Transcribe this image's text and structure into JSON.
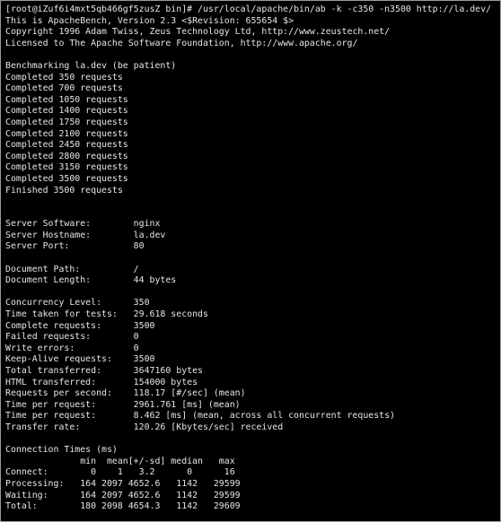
{
  "terminal": {
    "lines": [
      "[root@iZuf6i4mxt5qb466gf5zusZ bin]# /usr/local/apache/bin/ab -k -c350 -n3500 http://la.dev/",
      "This is ApacheBench, Version 2.3 <$Revision: 655654 $>",
      "Copyright 1996 Adam Twiss, Zeus Technology Ltd, http://www.zeustech.net/",
      "Licensed to The Apache Software Foundation, http://www.apache.org/",
      "",
      "Benchmarking la.dev (be patient)",
      "Completed 350 requests",
      "Completed 700 requests",
      "Completed 1050 requests",
      "Completed 1400 requests",
      "Completed 1750 requests",
      "Completed 2100 requests",
      "Completed 2450 requests",
      "Completed 2800 requests",
      "Completed 3150 requests",
      "Completed 3500 requests",
      "Finished 3500 requests",
      "",
      "",
      "Server Software:        nginx",
      "Server Hostname:        la.dev",
      "Server Port:            80",
      "",
      "Document Path:          /",
      "Document Length:        44 bytes",
      "",
      "Concurrency Level:      350",
      "Time taken for tests:   29.618 seconds",
      "Complete requests:      3500",
      "Failed requests:        0",
      "Write errors:           0",
      "Keep-Alive requests:    3500",
      "Total transferred:      3647160 bytes",
      "HTML transferred:       154000 bytes",
      "Requests per second:    118.17 [#/sec] (mean)",
      "Time per request:       2961.761 [ms] (mean)",
      "Time per request:       8.462 [ms] (mean, across all concurrent requests)",
      "Transfer rate:          120.26 [Kbytes/sec] received",
      "",
      "Connection Times (ms)",
      "              min  mean[+/-sd] median   max",
      "Connect:        0    1   3.2      0      16",
      "Processing:   164 2097 4652.6   1142   29599",
      "Waiting:      164 2097 4652.6   1142   29599",
      "Total:        180 2098 4654.3   1142   29609"
    ]
  }
}
